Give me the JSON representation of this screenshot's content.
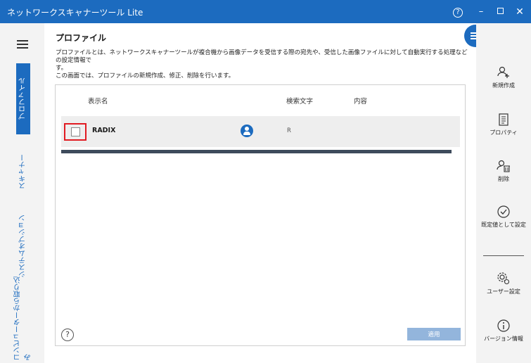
{
  "window": {
    "title": "ネットワークスキャナーツール Lite"
  },
  "titlebar": {
    "help_glyph": "?",
    "minimize_glyph": "–",
    "close_glyph": "✕"
  },
  "leftnav": {
    "tabs": [
      {
        "label": "プロファイル",
        "selected": true
      },
      {
        "label": "スキャナー"
      },
      {
        "label": "システムオプション"
      },
      {
        "label": "コンピューターから取り込み"
      }
    ]
  },
  "main": {
    "title": "プロファイル",
    "description_line1": "プロファイルとは、ネットワークスキャナーツールが複合機から画像データを受信する際の宛先や、受信した画像ファイルに対して自動実行する処理などの設定情報で",
    "description_line2": "す。",
    "description_line3": "この画面では、プロファイルの新規作成、修正、削除を行います。",
    "table": {
      "columns": [
        "表示名",
        "検索文字",
        "内容"
      ],
      "rows": [
        {
          "name": "RADIX",
          "search_key": "R",
          "content": "",
          "checked": false
        }
      ]
    },
    "apply_label": "適用",
    "help_glyph": "?"
  },
  "rightpanel": {
    "actions": [
      {
        "label": "新規作成",
        "icon": "add-user-icon"
      },
      {
        "label": "プロパティ",
        "icon": "document-icon"
      },
      {
        "label": "削除",
        "icon": "delete-user-icon"
      },
      {
        "label": "既定値として設定",
        "icon": "check-circle-icon"
      },
      {
        "label": "ユーザー設定",
        "icon": "gear-icon"
      },
      {
        "label": "バージョン情報",
        "icon": "info-icon"
      }
    ]
  },
  "colors": {
    "accent": "#1c6bbf",
    "highlight": "#e11b22",
    "apply_disabled": "#93b5dc"
  }
}
